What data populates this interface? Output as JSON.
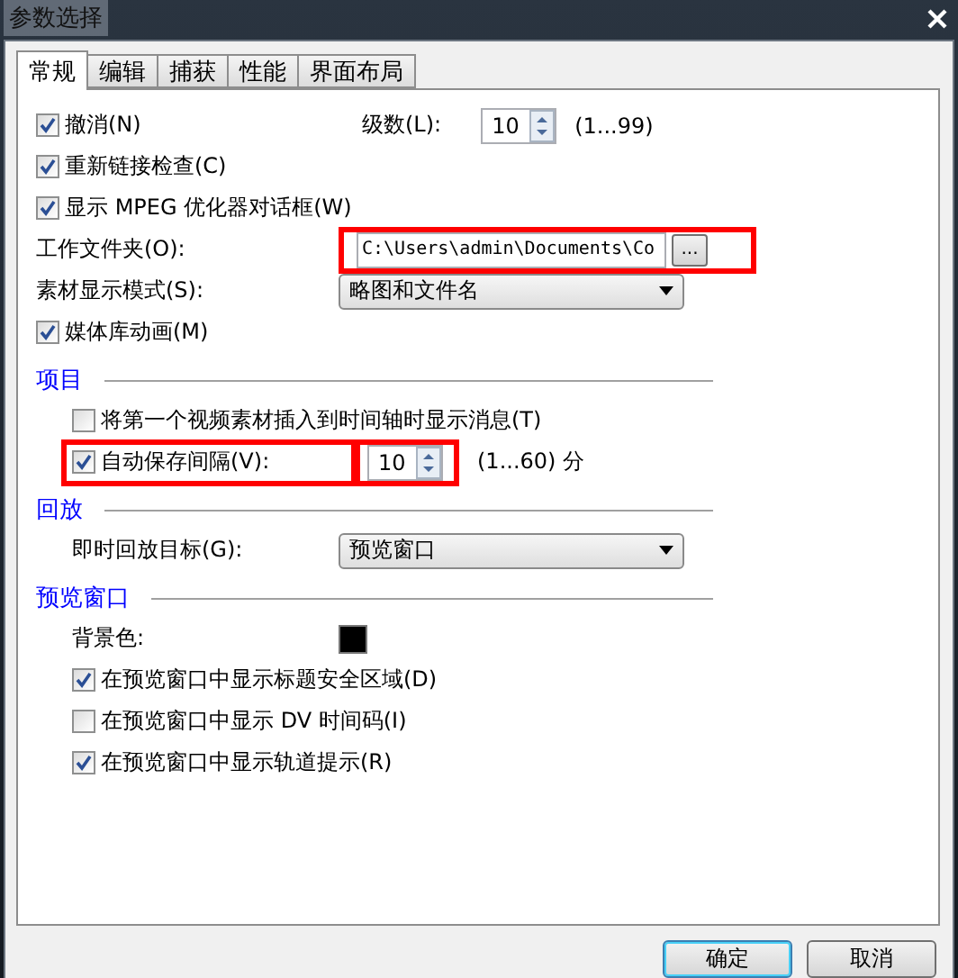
{
  "window": {
    "title": "参数选择"
  },
  "tabs": [
    {
      "label": "常规",
      "selected": true
    },
    {
      "label": "编辑",
      "selected": false
    },
    {
      "label": "捕获",
      "selected": false
    },
    {
      "label": "性能",
      "selected": false
    },
    {
      "label": "界面布局",
      "selected": false
    }
  ],
  "items": [
    {
      "kind": "checkbox",
      "label": "撤消(N)",
      "checked": true,
      "spin": {
        "label": "级数(L):",
        "value": "10",
        "range": "(1...99)"
      }
    },
    {
      "kind": "checkbox",
      "label": "重新链接检查(C)",
      "checked": true
    },
    {
      "kind": "checkbox",
      "label": "显示 MPEG 优化器对话框(W)",
      "checked": true
    },
    {
      "kind": "folder",
      "label": "工作文件夹(O):",
      "value": "C:\\Users\\admin\\Documents\\Co",
      "button": "...",
      "highlighted": true
    },
    {
      "kind": "select",
      "label": "素材显示模式(S):",
      "value": "略图和文件名"
    },
    {
      "kind": "checkbox",
      "label": "媒体库动画(M)",
      "checked": true
    },
    {
      "kind": "section",
      "title": "项目",
      "children": [
        {
          "kind": "checkbox",
          "label": "将第一个视频素材插入到时间轴时显示消息(T)",
          "checked": false
        },
        {
          "kind": "checkbox",
          "label": "自动保存间隔(V):",
          "checked": true,
          "highlighted": true,
          "spin": {
            "value": "10",
            "range": "(1...60) 分",
            "highlighted": true
          }
        }
      ]
    },
    {
      "kind": "section",
      "title": "回放",
      "children": [
        {
          "kind": "select",
          "label": "即时回放目标(G):",
          "value": "预览窗口"
        }
      ]
    },
    {
      "kind": "section",
      "title": "预览窗口",
      "children": [
        {
          "kind": "color",
          "label": "背景色:",
          "color": "#000000"
        },
        {
          "kind": "checkbox",
          "label": "在预览窗口中显示标题安全区域(D)",
          "checked": true
        },
        {
          "kind": "checkbox",
          "label": "在预览窗口中显示 DV 时间码(I)",
          "checked": false
        },
        {
          "kind": "checkbox",
          "label": "在预览窗口中显示轨道提示(R)",
          "checked": true
        }
      ]
    }
  ],
  "buttons": [
    {
      "label": "确定",
      "default": true
    },
    {
      "label": "取消",
      "default": false
    }
  ]
}
